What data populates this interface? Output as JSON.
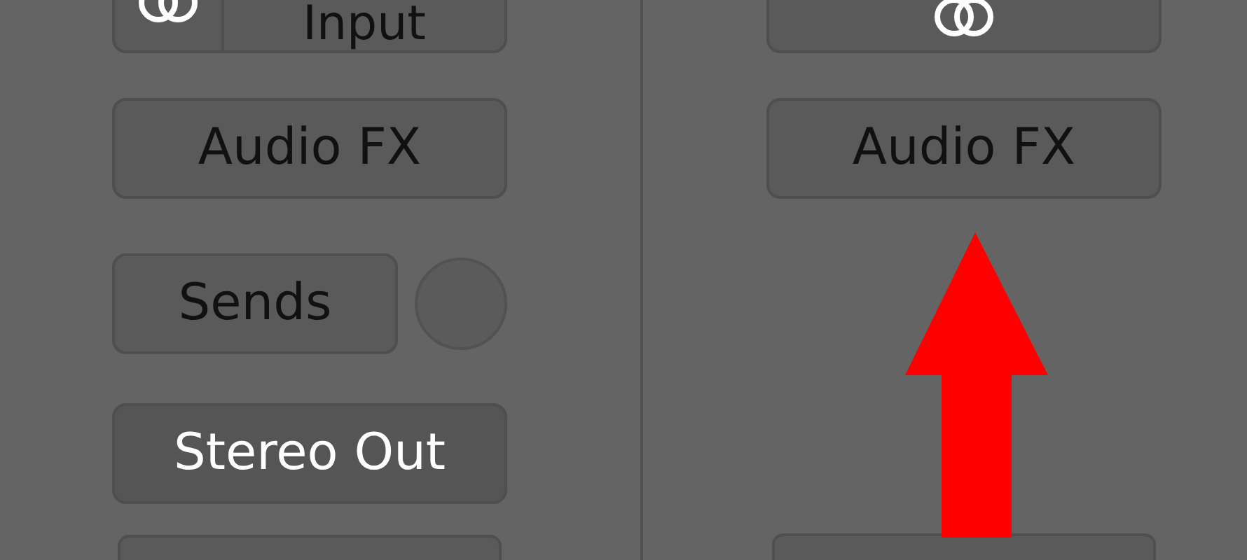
{
  "left_strip": {
    "input_slot": {
      "label": "Input"
    },
    "audio_fx": {
      "label": "Audio FX"
    },
    "sends": {
      "label": "Sends"
    },
    "output": {
      "label": "Stereo Out"
    }
  },
  "right_strip": {
    "audio_fx": {
      "label": "Audio FX"
    }
  }
}
